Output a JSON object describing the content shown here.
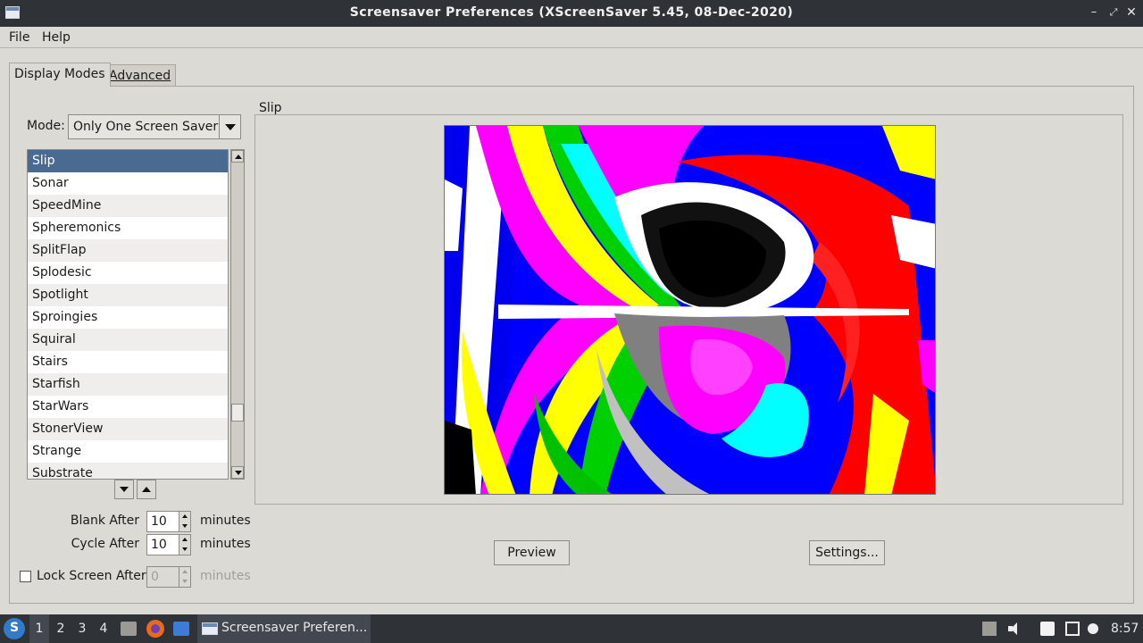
{
  "window": {
    "title": "Screensaver Preferences  (XScreenSaver 5.45, 08-Dec-2020)"
  },
  "menubar": {
    "file": "File",
    "help": "Help"
  },
  "tabs": [
    {
      "label": "Display Modes",
      "active": true
    },
    {
      "label": "Advanced",
      "active": false
    }
  ],
  "mode": {
    "label": "Mode:",
    "selected": "Only One Screen Saver"
  },
  "savers": [
    {
      "name": "Slip",
      "selected": true
    },
    {
      "name": "Sonar"
    },
    {
      "name": "SpeedMine"
    },
    {
      "name": "Spheremonics"
    },
    {
      "name": "SplitFlap"
    },
    {
      "name": "Splodesic"
    },
    {
      "name": "Spotlight"
    },
    {
      "name": "Sproingies"
    },
    {
      "name": "Squiral"
    },
    {
      "name": "Stairs"
    },
    {
      "name": "Starfish"
    },
    {
      "name": "StarWars"
    },
    {
      "name": "StonerView"
    },
    {
      "name": "Strange"
    },
    {
      "name": "Substrate"
    }
  ],
  "preview": {
    "frame_label": "Slip",
    "preview_button": "Preview",
    "settings_button": "Settings..."
  },
  "timing": {
    "blank_label": "Blank After",
    "blank_value": "10",
    "cycle_label": "Cycle After",
    "cycle_value": "10",
    "lock_label": "Lock Screen After",
    "lock_value": "0",
    "lock_checked": false,
    "units": "minutes"
  },
  "taskbar": {
    "workspaces": [
      "1",
      "2",
      "3",
      "4"
    ],
    "active_workspace": "1",
    "task_label": "Screensaver Preferen...",
    "clock": "8:57"
  },
  "colors": {
    "selection": "#4a6a91",
    "titlebar": "#2f3237",
    "window_bg": "#dcdad5"
  }
}
